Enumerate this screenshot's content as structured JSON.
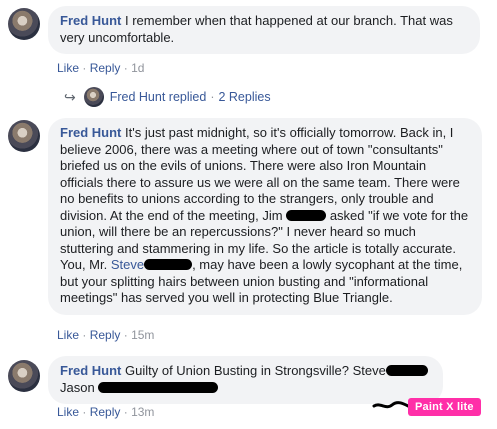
{
  "comments": [
    {
      "author": "Fred Hunt",
      "text": " I remember when that happened at our branch. That was very uncomfortable.",
      "like": "Like",
      "reply": "Reply",
      "time": "1d",
      "replies": {
        "author": "Fred Hunt replied",
        "count": "2 Replies"
      }
    },
    {
      "author": "Fred Hunt",
      "text_part1": " It's just past midnight, so it's officially tomorrow. Back in, I believe 2006, there was a meeting where out of town \"consultants\" briefed us on the evils of unions. There were also Iron Mountain officials there to assure us we were all on the same team. There were no benefits to unions according to the strangers, only trouble and division. At the end of the meeting, Jim",
      "text_part2": " asked \"if we vote for the union, will there be an repercussions?\" I never heard so much stuttering and stammering in my life. So the article is totally accurate. You, Mr. ",
      "mention": "Steve",
      "text_part3": ", may have been a lowly sycophant at the time, but your splitting hairs between union busting and \"informational meetings\" has served you well in protecting Blue Triangle.",
      "like": "Like",
      "reply": "Reply",
      "time": "15m"
    },
    {
      "author": "Fred Hunt",
      "text_part1": " Guilty of Union Busting in Strongsville? Steve",
      "text_part2": "Jason",
      "like": "Like",
      "reply": "Reply",
      "time": "13m"
    }
  ],
  "watermark": "Paint X lite"
}
